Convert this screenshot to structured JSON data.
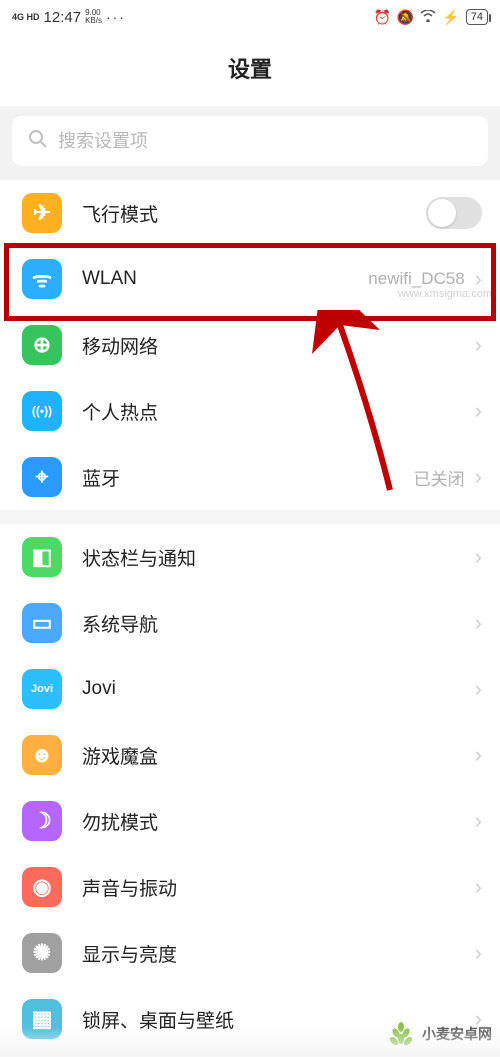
{
  "status": {
    "signal": "4G HD",
    "time": "12:47",
    "speed_top": "9.00",
    "speed_bot": "KB/s",
    "dots": "···",
    "battery": "74"
  },
  "header": {
    "title": "设置"
  },
  "search": {
    "placeholder": "搜索设置项"
  },
  "groups": [
    {
      "items": [
        {
          "id": "airplane",
          "label": "飞行模式",
          "value": "",
          "type": "toggle",
          "icon": "airplane"
        },
        {
          "id": "wlan",
          "label": "WLAN",
          "value": "newifi_DC58",
          "type": "link",
          "icon": "wlan"
        },
        {
          "id": "mobile",
          "label": "移动网络",
          "value": "",
          "type": "link",
          "icon": "mobile"
        },
        {
          "id": "hotspot",
          "label": "个人热点",
          "value": "",
          "type": "link",
          "icon": "hotspot"
        },
        {
          "id": "bluetooth",
          "label": "蓝牙",
          "value": "已关闭",
          "type": "link",
          "icon": "bt"
        }
      ]
    },
    {
      "items": [
        {
          "id": "statusbar",
          "label": "状态栏与通知",
          "value": "",
          "type": "link",
          "icon": "status"
        },
        {
          "id": "navigation",
          "label": "系统导航",
          "value": "",
          "type": "link",
          "icon": "nav"
        },
        {
          "id": "jovi",
          "label": "Jovi",
          "value": "",
          "type": "link",
          "icon": "jovi"
        },
        {
          "id": "gamebox",
          "label": "游戏魔盒",
          "value": "",
          "type": "link",
          "icon": "game"
        },
        {
          "id": "dnd",
          "label": "勿扰模式",
          "value": "",
          "type": "link",
          "icon": "dnd"
        },
        {
          "id": "sound",
          "label": "声音与振动",
          "value": "",
          "type": "link",
          "icon": "sound"
        },
        {
          "id": "display",
          "label": "显示与亮度",
          "value": "",
          "type": "link",
          "icon": "display"
        },
        {
          "id": "wallpaper",
          "label": "锁屏、桌面与壁纸",
          "value": "",
          "type": "link",
          "icon": "wall"
        }
      ]
    }
  ],
  "watermark1": "www.xmsigma.com",
  "watermark2": "小麦安卓网",
  "icon_glyphs": {
    "airplane": "✈",
    "wlan": "ᯤ",
    "mobile": "⊕",
    "hotspot": "((•))",
    "bt": "⌖",
    "status": "◧",
    "nav": "▭",
    "jovi": "Jovi",
    "game": "☻",
    "dnd": "☽",
    "sound": "◉",
    "display": "✺",
    "wall": "▦"
  }
}
